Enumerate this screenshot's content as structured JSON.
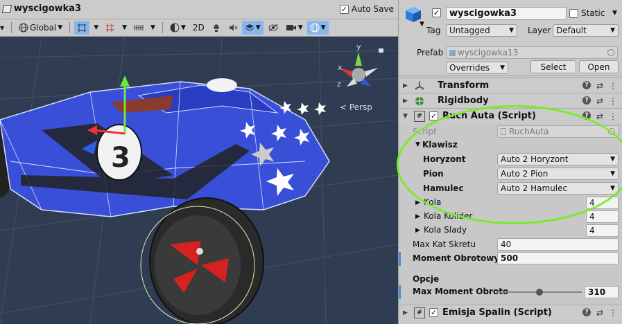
{
  "scene": {
    "title": "wyscigowka3",
    "autosave_label": "Auto Save",
    "autosave_checked": "✓",
    "global_label": "Global",
    "mode_2d_label": "2D",
    "persp_label": "< Persp",
    "gizmo_axes": {
      "x": "x",
      "y": "y",
      "z": "z"
    }
  },
  "inspector": {
    "object_name": "wyscigowka3",
    "active_check": "✓",
    "static_label": "Static",
    "tag_label": "Tag",
    "tag_value": "Untagged",
    "layer_label": "Layer",
    "layer_value": "Default",
    "prefab_label": "Prefab",
    "prefab_value": "wyscigowka13",
    "overrides_label": "Overrides",
    "select_label": "Select",
    "open_label": "Open",
    "components": [
      {
        "title": "Transform"
      },
      {
        "title": "Rigidbody"
      },
      {
        "title": "Ruch Auta (Script)"
      },
      {
        "title": "Emisja Spalin (Script)"
      }
    ],
    "script_label": "Script",
    "script_value": "RuchAuta",
    "klawisz_label": "Klawisz",
    "horyzont_label": "Horyzont",
    "horyzont_value": "Auto 2 Horyzont",
    "pion_label": "Pion",
    "pion_value": "Auto 2 Pion",
    "hamulec_label": "Hamulec",
    "hamulec_value": "Auto 2 Hamulec",
    "kola_label": "Kola",
    "kola_value": "4",
    "kola_kolider_label": "Kola Kolider",
    "kola_kolider_value": "4",
    "kola_slady_label": "Kola Slady",
    "kola_slady_value": "4",
    "max_kat_label": "Max Kat Skretu",
    "max_kat_value": "40",
    "moment_label": "Moment Obrotowy H",
    "moment_value": "500",
    "opcje_label": "Opcje",
    "max_moment_label": "Max Moment Obroto",
    "max_moment_value": "310",
    "max_moment_slider_fraction": 0.5
  },
  "colors": {
    "scene_bg": "#2f3c52",
    "car_body": "#3a4fd8",
    "highlight": "#7bea2c",
    "selected_tool": "#89b4ec"
  }
}
